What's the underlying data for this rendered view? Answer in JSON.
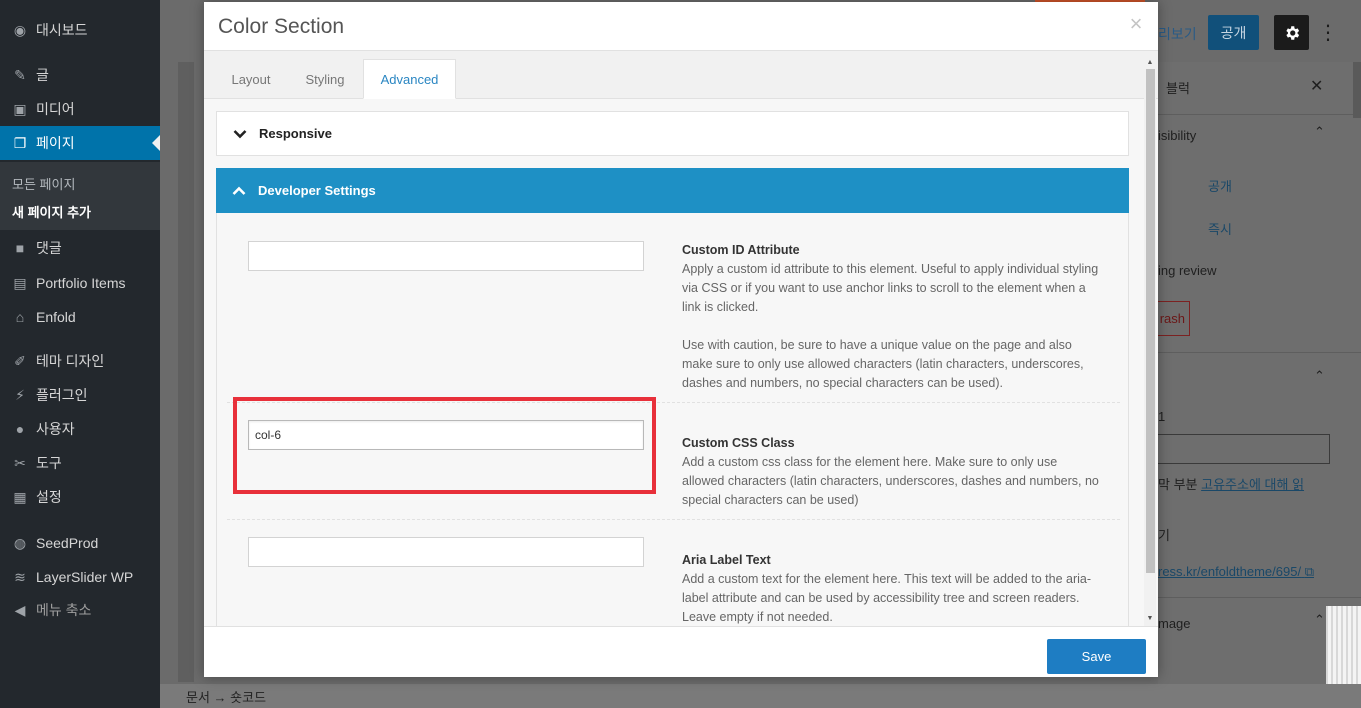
{
  "sidebar": {
    "items": [
      {
        "label": "대시보드",
        "icon": "dashboard-icon"
      },
      {
        "label": "글",
        "icon": "pin-icon"
      },
      {
        "label": "미디어",
        "icon": "media-icon"
      },
      {
        "label": "페이지",
        "icon": "pages-icon"
      },
      {
        "label": "댓글",
        "icon": "comments-icon"
      },
      {
        "label": "Portfolio Items",
        "icon": "portfolio-icon"
      },
      {
        "label": "Enfold",
        "icon": "home-icon"
      },
      {
        "label": "테마 디자인",
        "icon": "brush-icon"
      },
      {
        "label": "플러그인",
        "icon": "plugin-icon"
      },
      {
        "label": "사용자",
        "icon": "user-icon"
      },
      {
        "label": "도구",
        "icon": "wrench-icon"
      },
      {
        "label": "설정",
        "icon": "settings-icon"
      },
      {
        "label": "SeedProd",
        "icon": "seedprod-icon"
      },
      {
        "label": "LayerSlider WP",
        "icon": "layers-icon"
      },
      {
        "label": "메뉴 축소",
        "icon": "collapse-icon"
      }
    ],
    "submenu": [
      "모든 페이지",
      "새 페이지 추가"
    ]
  },
  "editor": {
    "preview_label": "리보기",
    "publish_label": "공개",
    "footer_breadcrumb": "문서 → 숏코드"
  },
  "right_panel": {
    "tab_label": "블럭",
    "visibility_label": "isibility",
    "visibility_value": "공개",
    "publish_value": "즉시",
    "pending_label": "ing review",
    "trash_label": "rash",
    "permalink_num": "1",
    "permalink_text": "막 부분",
    "permalink_link": "고유주소에 대해 읽",
    "view_label": "기",
    "url_text": "ress.kr/enfoldtheme/695/",
    "image_label": "mage"
  },
  "modal": {
    "title": "Color Section",
    "tabs": [
      "Layout",
      "Styling",
      "Advanced"
    ],
    "active_tab": "Advanced",
    "sections": {
      "responsive": "Responsive",
      "developer": "Developer Settings"
    },
    "fields": {
      "custom_id": {
        "title": "Custom ID Attribute",
        "value": "",
        "desc1": "Apply a custom id attribute to this element. Useful to apply individual styling via CSS or if you want to use anchor links to scroll to the element when a link is clicked.",
        "desc2": "Use with caution, be sure to have a unique value on the page and also make sure to only use allowed characters (latin characters, underscores, dashes and numbers, no special characters can be used)."
      },
      "custom_css": {
        "title": "Custom CSS Class",
        "value": "col-6",
        "desc": "Add a custom css class for the element here. Make sure to only use allowed characters (latin characters, underscores, dashes and numbers, no special characters can be used)"
      },
      "aria_label": {
        "title": "Aria Label Text",
        "value": "",
        "desc": "Add a custom text for the element here. This text will be added to the aria-label attribute and can be used by accessibility tree and screen readers. Leave empty if not needed."
      }
    },
    "save_label": "Save"
  },
  "colors": {
    "accent": "#1e90c5",
    "save_button": "#1e7dc3",
    "highlight": "#e8303a",
    "sidebar_bg": "#23282d"
  }
}
